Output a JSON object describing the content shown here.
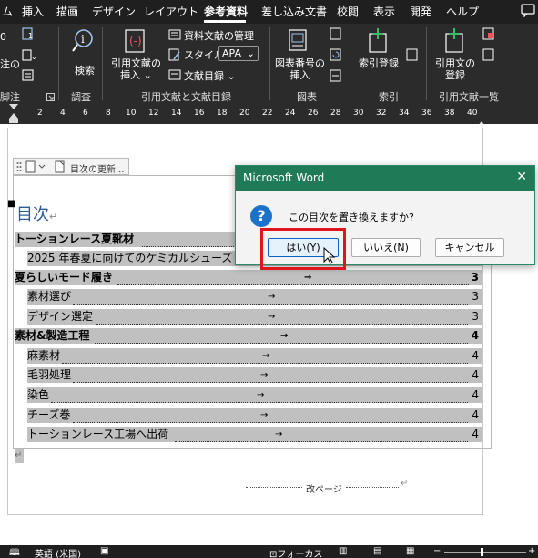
{
  "ribbon_tabs": [
    "ム",
    "挿入",
    "描画",
    "デザイン",
    "レイアウト",
    "参考資料",
    "差し込み文書",
    "校閲",
    "表示",
    "開発",
    "ヘルプ"
  ],
  "ribbon": {
    "footnote_partial_label": "注の",
    "footnote_group_label": "脚注",
    "research_button_label": "検索",
    "research_group_label": "調査",
    "insert_citation_label_1": "引用文献の",
    "insert_citation_label_2": "挿入",
    "manage_sources_label": "資料文献の管理",
    "style_label": "スタイル:",
    "style_value": "APA",
    "bibliography_label": "文献目録",
    "citations_group_label": "引用文献と文献目録",
    "insert_caption_label_1": "図表番号の",
    "insert_caption_label_2": "挿入",
    "captions_group_label": "図表",
    "mark_entry_label": "索引登録",
    "index_group_label": "索引",
    "mark_citation_label_1": "引用文の",
    "mark_citation_label_2": "登録",
    "toa_group_label": "引用文献一覧"
  },
  "ruler_numbers": [
    "2",
    "4",
    "6",
    "8",
    "10",
    "12",
    "14",
    "16",
    "18",
    "20",
    "22",
    "24",
    "26",
    "28",
    "30",
    "32",
    "34",
    "36",
    "38",
    "40"
  ],
  "toc": {
    "update_button_label": "目次の更新...",
    "title": "目次",
    "entries": [
      {
        "text": "トーションレース夏靴材",
        "page": "",
        "bold": true
      },
      {
        "text": "2025 年春夏に向けてのケミカルシューズ",
        "page": "",
        "bold": false
      },
      {
        "text": "夏らしいモード履き",
        "page": "3",
        "bold": true
      },
      {
        "text": "素材選び",
        "page": "3",
        "bold": false
      },
      {
        "text": "デザイン選定",
        "page": "3",
        "bold": false
      },
      {
        "text": "素材&製造工程",
        "page": "4",
        "bold": true
      },
      {
        "text": "麻素材",
        "page": "4",
        "bold": false
      },
      {
        "text": "毛羽処理",
        "page": "4",
        "bold": false
      },
      {
        "text": "染色",
        "page": "4",
        "bold": false
      },
      {
        "text": "チーズ巻",
        "page": "4",
        "bold": false
      },
      {
        "text": "トーションレース工場へ出荷",
        "page": "4",
        "bold": false
      }
    ]
  },
  "page_break_label": "改ページ",
  "dialog": {
    "title": "Microsoft Word",
    "message": "この目次を置き換えますか?",
    "yes_label": "はい(Y)",
    "no_label": "いいえ(N)",
    "cancel_label": "キャンセル",
    "titlebar_color": "#1e7a57"
  },
  "status": {
    "language": "英語 (米国)",
    "focus_label": "フォーカス"
  }
}
